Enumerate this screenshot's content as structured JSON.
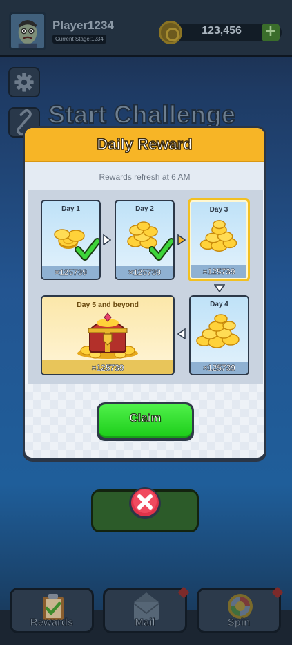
{
  "player": {
    "name": "Player1234",
    "stage": "Current Stage:1234"
  },
  "currency": {
    "coins": "123,456",
    "plus_label": "+"
  },
  "background": {
    "title": "Start Challenge"
  },
  "dialog": {
    "title": "Daily Reward",
    "subtitle": "Rewards refresh at 6 AM",
    "claim_label": "Claim",
    "days": [
      {
        "label": "Day 1",
        "amount": "×125739",
        "claimed": true
      },
      {
        "label": "Day 2",
        "amount": "×125739",
        "claimed": true
      },
      {
        "label": "Day 3",
        "amount": "×125739",
        "claimed": false,
        "current": true
      },
      {
        "label": "Day 4",
        "amount": "×125739",
        "claimed": false
      },
      {
        "label": "Day 5 and beyond",
        "amount": "×125739",
        "claimed": false
      }
    ]
  },
  "tabs": [
    {
      "label": "Rewards",
      "badge": false
    },
    {
      "label": "Mail",
      "badge": true
    },
    {
      "label": "Spin",
      "badge": true
    }
  ],
  "colors": {
    "accent": "#f7b526",
    "claim": "#2fdb2a",
    "close": "#e0334a"
  },
  "icons": [
    "gear-icon",
    "link-icon",
    "coin-icon",
    "plus-icon",
    "check-icon",
    "close-icon",
    "clipboard-icon",
    "mail-icon",
    "spin-wheel-icon",
    "treasure-chest-icon"
  ]
}
